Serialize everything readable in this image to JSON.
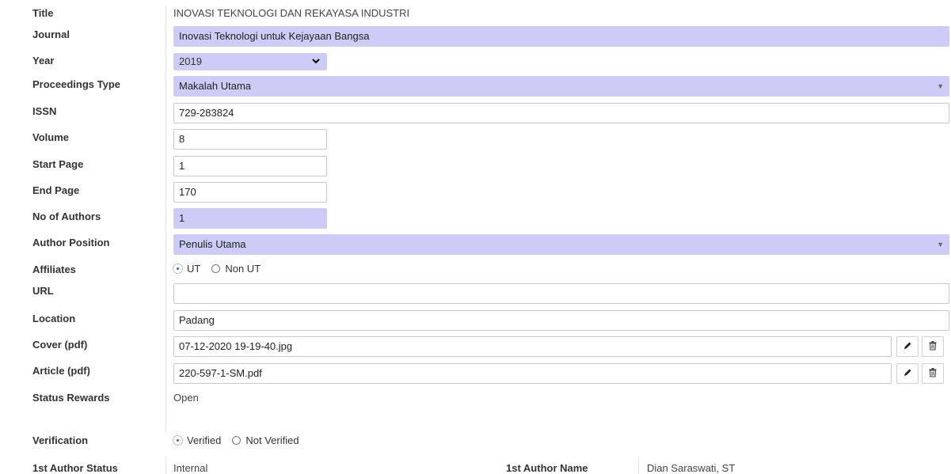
{
  "labels": {
    "title": "Title",
    "journal": "Journal",
    "year": "Year",
    "proceedings_type": "Proceedings Type",
    "issn": "ISSN",
    "volume": "Volume",
    "start_page": "Start Page",
    "end_page": "End Page",
    "no_of_authors": "No of Authors",
    "author_position": "Author Position",
    "affiliates": "Affiliates",
    "url": "URL",
    "location": "Location",
    "cover": "Cover (pdf)",
    "article": "Article (pdf)",
    "status_rewards": "Status Rewards",
    "verification": "Verification"
  },
  "values": {
    "title": "INOVASI TEKNOLOGI DAN REKAYASA INDUSTRI",
    "journal": "Inovasi Teknologi untuk Kejayaan Bangsa",
    "year": "2019",
    "proceedings_type": "Makalah Utama",
    "issn": "729-283824",
    "volume": "8",
    "start_page": "1",
    "end_page": "170",
    "no_of_authors": "1",
    "author_position": "Penulis Utama",
    "url": "",
    "location": "Padang",
    "cover": "07-12-2020 19-19-40.jpg",
    "article": "220-597-1-SM.pdf",
    "status_rewards": "Open"
  },
  "affiliates": {
    "options": [
      "UT",
      "Non UT"
    ],
    "selected": "UT"
  },
  "verification": {
    "options": [
      "Verified",
      "Not Verified"
    ],
    "selected": "Verified"
  },
  "footer": {
    "author_status_label": "1st Author Status",
    "author_status_value": "Internal",
    "author_name_label": "1st Author Name",
    "author_name_value": "Dian Saraswati, ST"
  },
  "icons": {
    "edit": "pencil-icon",
    "delete": "trash-icon",
    "dropdown": "caret-down-icon"
  },
  "colors": {
    "readonly_bg": "#ccccf7",
    "radio_selected": "#2a6ad0"
  }
}
